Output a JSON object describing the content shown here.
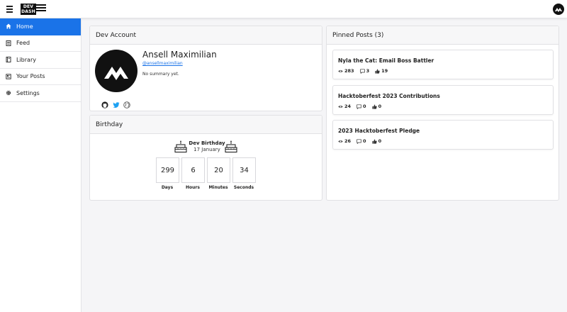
{
  "app": {
    "logo_text_line1": "DEV",
    "logo_text_line2": "DASH"
  },
  "sidebar": {
    "items": [
      {
        "label": "Home",
        "icon": "home-icon",
        "active": true
      },
      {
        "label": "Feed",
        "icon": "feed-icon",
        "active": false
      },
      {
        "label": "Library",
        "icon": "library-icon",
        "active": false
      },
      {
        "label": "Your Posts",
        "icon": "posts-icon",
        "active": false
      },
      {
        "label": "Settings",
        "icon": "gear-icon",
        "active": false
      }
    ]
  },
  "account": {
    "title": "Dev Account",
    "name": "Ansell Maximilian",
    "handle": "@ansellmaximilian",
    "summary": "No summary yet."
  },
  "birthday": {
    "title": "Birthday",
    "label": "Dev Birthday",
    "date": "17 January",
    "countdown": [
      {
        "value": "299",
        "label": "Days"
      },
      {
        "value": "6",
        "label": "Hours"
      },
      {
        "value": "20",
        "label": "Minutes"
      },
      {
        "value": "34",
        "label": "Seconds"
      }
    ]
  },
  "pinned": {
    "title": "Pinned Posts (3)",
    "posts": [
      {
        "title": "Nyla the Cat: Email Boss Battler",
        "views": "283",
        "comments": "3",
        "likes": "19"
      },
      {
        "title": "Hacktoberfest 2023 Contributions",
        "views": "24",
        "comments": "0",
        "likes": "0"
      },
      {
        "title": "2023 Hacktoberfest Pledge",
        "views": "26",
        "comments": "0",
        "likes": "0"
      }
    ]
  },
  "colors": {
    "accent": "#1a73e8",
    "twitter": "#1da1f2"
  }
}
